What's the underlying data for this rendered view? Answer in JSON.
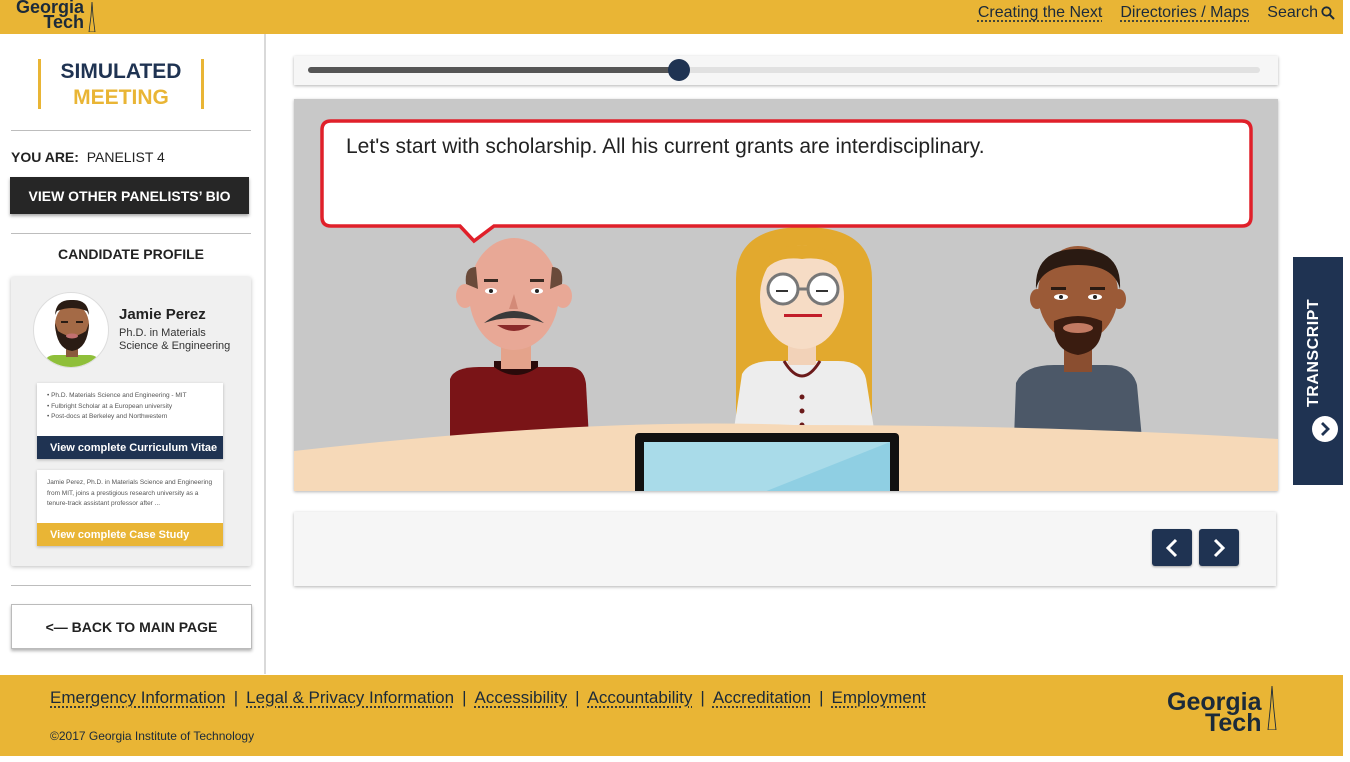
{
  "header": {
    "logo_line1": "Georgia",
    "logo_line2": "Tech",
    "links": [
      "Creating the Next",
      "Directories / Maps"
    ],
    "search_label": "Search"
  },
  "sidebar": {
    "title_line1": "SIMULATED",
    "title_line2": "MEETING",
    "you_are_label": "YOU ARE:",
    "you_are_value": "PANELIST 4",
    "bio_button": "VIEW OTHER PANELISTS’ BIO",
    "candidate_heading": "CANDIDATE PROFILE",
    "candidate": {
      "name": "Jamie Perez",
      "degree": "Ph.D. in Materials Science & Engineering"
    },
    "cv_card": {
      "bullets": [
        "• Ph.D. Materials Science and Engineering - MIT",
        "• Fulbright Scholar at a European university",
        "• Post-docs at Berkeley and Northwestern"
      ],
      "action": "View complete Curriculum Vitae"
    },
    "case_card": {
      "summary": "Jamie Perez, Ph.D. in Materials Science and Engineering from MIT, joins a prestigious research university as a tenure-track assistant professor after ...",
      "action": "View complete Case Study"
    },
    "back_button": "<— BACK TO MAIN PAGE"
  },
  "player": {
    "progress": 0.39,
    "speech": "Let's start with scholarship. All his current grants are interdisciplinary.",
    "transcript_label": "TRANSCRIPT"
  },
  "footer": {
    "links": [
      "Emergency Information",
      "Legal & Privacy Information",
      "Accessibility",
      "Accountability",
      "Accreditation",
      "Employment"
    ],
    "separator": "|",
    "copyright": "©2017 Georgia Institute of Technology",
    "logo_line1": "Georgia",
    "logo_line2": "Tech"
  },
  "colors": {
    "gold": "#e9b535",
    "navy": "#1f3352",
    "bubble_border": "#e0202a"
  },
  "icons": [
    "search-icon",
    "chevron-left-icon",
    "chevron-right-icon",
    "chevron-right-circle-icon",
    "spire-icon"
  ]
}
